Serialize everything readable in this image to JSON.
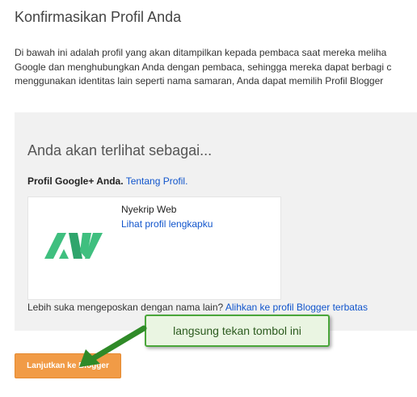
{
  "page_title": "Konfirmasikan Profil Anda",
  "intro": {
    "line1": "Di bawah ini adalah profil yang akan ditampilkan kepada pembaca saat mereka meliha",
    "line2": "Google dan menghubungkan Anda dengan pembaca, sehingga mereka dapat berbagi c",
    "line3": "menggunakan identitas lain seperti nama samaran, Anda dapat memilih Profil Blogger"
  },
  "panel": {
    "heading": "Anda akan terlihat sebagai...",
    "profile_label": "Profil Google+ Anda.",
    "about_profile_link": "Tentang Profil.",
    "card": {
      "name": "Nyekrip Web",
      "view_profile_link": "Lihat profil lengkapku"
    },
    "alt_text": "Lebih suka mengeposkan dengan nama lain?",
    "alt_link": "Alihkan ke profil Blogger terbatas"
  },
  "continue_button": "Lanjutkan ke Blogger",
  "callout": "langsung tekan tombol ini",
  "colors": {
    "link": "#1155cc",
    "button": "#f19b46",
    "callout_border": "#4aa63a",
    "logo": "#3fbf7f"
  }
}
